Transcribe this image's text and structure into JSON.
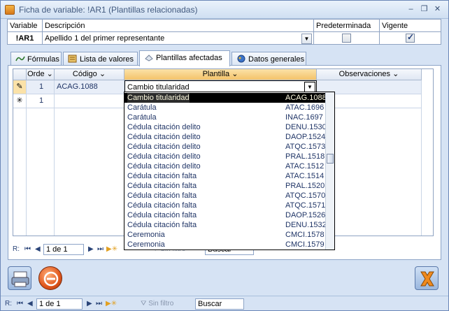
{
  "window": {
    "title": "Ficha de variable: !AR1 (Plantillas relacionadas)"
  },
  "fields": {
    "headers": {
      "variable": "Variable",
      "descripcion": "Descripción",
      "predeterminada": "Predeterminada",
      "vigente": "Vigente"
    },
    "variable": "!AR1",
    "descripcion": "Apellido 1 del primer representante",
    "predeterminada_checked": false,
    "vigente_checked": true
  },
  "tabs": [
    {
      "label": "Fórmulas"
    },
    {
      "label": "Lista de valores"
    },
    {
      "label": "Plantillas afectadas"
    },
    {
      "label": "Datos generales"
    }
  ],
  "grid": {
    "columns": {
      "orden": "Orde",
      "codigo": "Código",
      "plantilla": "Plantilla",
      "observaciones": "Observaciones"
    },
    "row1": {
      "orden": "1",
      "codigo": "ACAG.1088",
      "plantilla": "Cambio titularidad"
    },
    "row2": {
      "orden": "1"
    }
  },
  "dropdown": {
    "items": [
      {
        "name": "Cambio titularidad",
        "code": "ACAG.1088"
      },
      {
        "name": "Carátula",
        "code": "ATAC.1696"
      },
      {
        "name": "Carátula",
        "code": "INAC.1697"
      },
      {
        "name": "Cédula citación delito",
        "code": "DENU.1530"
      },
      {
        "name": "Cédula citación delito",
        "code": "DAOP.1524"
      },
      {
        "name": "Cédula citación delito",
        "code": "ATQC.1573"
      },
      {
        "name": "Cédula citación delito",
        "code": "PRAL.1518"
      },
      {
        "name": "Cédula citación delito",
        "code": "ATAC.1512"
      },
      {
        "name": "Cédula citación falta",
        "code": "ATAC.1514"
      },
      {
        "name": "Cédula citación falta",
        "code": "PRAL.1520"
      },
      {
        "name": "Cédula citación falta",
        "code": "ATQC.1570"
      },
      {
        "name": "Cédula citación falta",
        "code": "ATQC.1571"
      },
      {
        "name": "Cédula citación falta",
        "code": "DAOP.1526"
      },
      {
        "name": "Cédula citación falta",
        "code": "DENU.1532"
      },
      {
        "name": "Ceremonia",
        "code": "CMCI.1578"
      },
      {
        "name": "Ceremonia",
        "code": "CMCI.1579"
      }
    ]
  },
  "inner_nav": {
    "prefix": "R:",
    "record": "1 de 1",
    "filter": "Sin filtro",
    "search": "Buscar"
  },
  "outer_nav": {
    "prefix": "R:",
    "record": "1 de 1",
    "filter": "Sin filtro",
    "search": "Buscar"
  }
}
